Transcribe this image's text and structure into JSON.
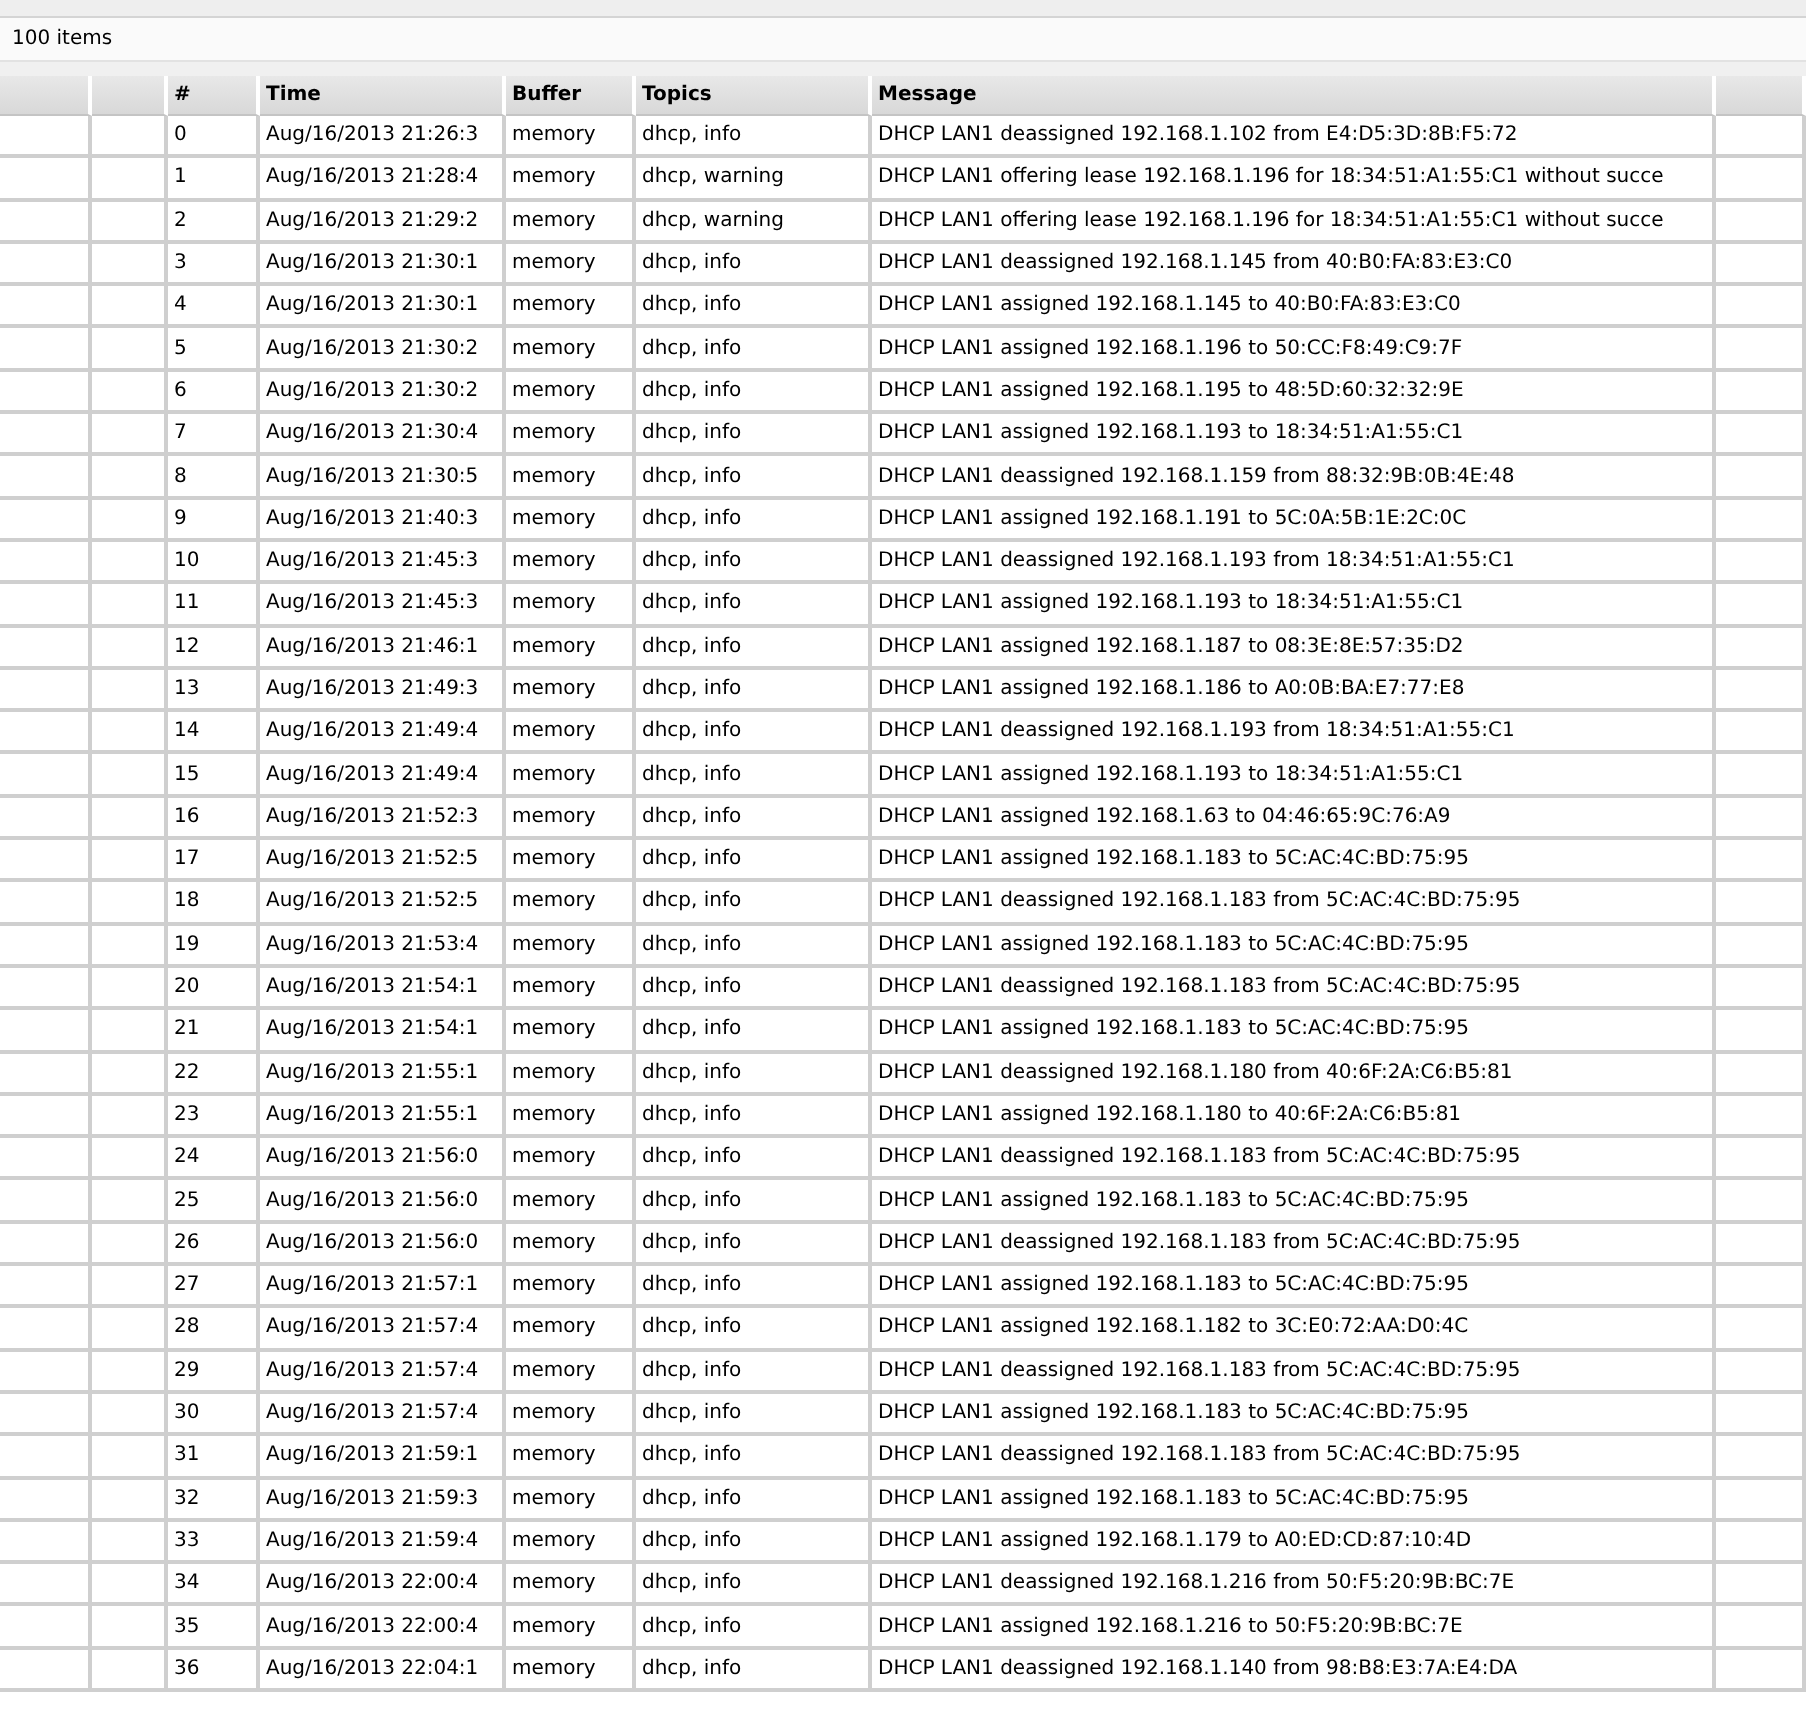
{
  "status": "100 items",
  "columns": [
    "#",
    "Time",
    "Buffer",
    "Topics",
    "Message"
  ],
  "rows": [
    [
      "0",
      "Aug/16/2013 21:26:3",
      "memory",
      "dhcp, info",
      "DHCP LAN1 deassigned 192.168.1.102 from E4:D5:3D:8B:F5:72"
    ],
    [
      "1",
      "Aug/16/2013 21:28:4",
      "memory",
      "dhcp, warning",
      "DHCP LAN1 offering lease 192.168.1.196 for 18:34:51:A1:55:C1 without succe"
    ],
    [
      "2",
      "Aug/16/2013 21:29:2",
      "memory",
      "dhcp, warning",
      "DHCP LAN1 offering lease 192.168.1.196 for 18:34:51:A1:55:C1 without succe"
    ],
    [
      "3",
      "Aug/16/2013 21:30:1",
      "memory",
      "dhcp, info",
      "DHCP LAN1 deassigned 192.168.1.145 from 40:B0:FA:83:E3:C0"
    ],
    [
      "4",
      "Aug/16/2013 21:30:1",
      "memory",
      "dhcp, info",
      "DHCP LAN1 assigned 192.168.1.145 to 40:B0:FA:83:E3:C0"
    ],
    [
      "5",
      "Aug/16/2013 21:30:2",
      "memory",
      "dhcp, info",
      "DHCP LAN1 assigned 192.168.1.196 to 50:CC:F8:49:C9:7F"
    ],
    [
      "6",
      "Aug/16/2013 21:30:2",
      "memory",
      "dhcp, info",
      "DHCP LAN1 assigned 192.168.1.195 to 48:5D:60:32:32:9E"
    ],
    [
      "7",
      "Aug/16/2013 21:30:4",
      "memory",
      "dhcp, info",
      "DHCP LAN1 assigned 192.168.1.193 to 18:34:51:A1:55:C1"
    ],
    [
      "8",
      "Aug/16/2013 21:30:5",
      "memory",
      "dhcp, info",
      "DHCP LAN1 deassigned 192.168.1.159 from 88:32:9B:0B:4E:48"
    ],
    [
      "9",
      "Aug/16/2013 21:40:3",
      "memory",
      "dhcp, info",
      "DHCP LAN1 assigned 192.168.1.191 to 5C:0A:5B:1E:2C:0C"
    ],
    [
      "10",
      "Aug/16/2013 21:45:3",
      "memory",
      "dhcp, info",
      "DHCP LAN1 deassigned 192.168.1.193 from 18:34:51:A1:55:C1"
    ],
    [
      "11",
      "Aug/16/2013 21:45:3",
      "memory",
      "dhcp, info",
      "DHCP LAN1 assigned 192.168.1.193 to 18:34:51:A1:55:C1"
    ],
    [
      "12",
      "Aug/16/2013 21:46:1",
      "memory",
      "dhcp, info",
      "DHCP LAN1 assigned 192.168.1.187 to 08:3E:8E:57:35:D2"
    ],
    [
      "13",
      "Aug/16/2013 21:49:3",
      "memory",
      "dhcp, info",
      "DHCP LAN1 assigned 192.168.1.186 to A0:0B:BA:E7:77:E8"
    ],
    [
      "14",
      "Aug/16/2013 21:49:4",
      "memory",
      "dhcp, info",
      "DHCP LAN1 deassigned 192.168.1.193 from 18:34:51:A1:55:C1"
    ],
    [
      "15",
      "Aug/16/2013 21:49:4",
      "memory",
      "dhcp, info",
      "DHCP LAN1 assigned 192.168.1.193 to 18:34:51:A1:55:C1"
    ],
    [
      "16",
      "Aug/16/2013 21:52:3",
      "memory",
      "dhcp, info",
      "DHCP LAN1 assigned 192.168.1.63 to 04:46:65:9C:76:A9"
    ],
    [
      "17",
      "Aug/16/2013 21:52:5",
      "memory",
      "dhcp, info",
      "DHCP LAN1 assigned 192.168.1.183 to 5C:AC:4C:BD:75:95"
    ],
    [
      "18",
      "Aug/16/2013 21:52:5",
      "memory",
      "dhcp, info",
      "DHCP LAN1 deassigned 192.168.1.183 from 5C:AC:4C:BD:75:95"
    ],
    [
      "19",
      "Aug/16/2013 21:53:4",
      "memory",
      "dhcp, info",
      "DHCP LAN1 assigned 192.168.1.183 to 5C:AC:4C:BD:75:95"
    ],
    [
      "20",
      "Aug/16/2013 21:54:1",
      "memory",
      "dhcp, info",
      "DHCP LAN1 deassigned 192.168.1.183 from 5C:AC:4C:BD:75:95"
    ],
    [
      "21",
      "Aug/16/2013 21:54:1",
      "memory",
      "dhcp, info",
      "DHCP LAN1 assigned 192.168.1.183 to 5C:AC:4C:BD:75:95"
    ],
    [
      "22",
      "Aug/16/2013 21:55:1",
      "memory",
      "dhcp, info",
      "DHCP LAN1 deassigned 192.168.1.180 from 40:6F:2A:C6:B5:81"
    ],
    [
      "23",
      "Aug/16/2013 21:55:1",
      "memory",
      "dhcp, info",
      "DHCP LAN1 assigned 192.168.1.180 to 40:6F:2A:C6:B5:81"
    ],
    [
      "24",
      "Aug/16/2013 21:56:0",
      "memory",
      "dhcp, info",
      "DHCP LAN1 deassigned 192.168.1.183 from 5C:AC:4C:BD:75:95"
    ],
    [
      "25",
      "Aug/16/2013 21:56:0",
      "memory",
      "dhcp, info",
      "DHCP LAN1 assigned 192.168.1.183 to 5C:AC:4C:BD:75:95"
    ],
    [
      "26",
      "Aug/16/2013 21:56:0",
      "memory",
      "dhcp, info",
      "DHCP LAN1 deassigned 192.168.1.183 from 5C:AC:4C:BD:75:95"
    ],
    [
      "27",
      "Aug/16/2013 21:57:1",
      "memory",
      "dhcp, info",
      "DHCP LAN1 assigned 192.168.1.183 to 5C:AC:4C:BD:75:95"
    ],
    [
      "28",
      "Aug/16/2013 21:57:4",
      "memory",
      "dhcp, info",
      "DHCP LAN1 assigned 192.168.1.182 to 3C:E0:72:AA:D0:4C"
    ],
    [
      "29",
      "Aug/16/2013 21:57:4",
      "memory",
      "dhcp, info",
      "DHCP LAN1 deassigned 192.168.1.183 from 5C:AC:4C:BD:75:95"
    ],
    [
      "30",
      "Aug/16/2013 21:57:4",
      "memory",
      "dhcp, info",
      "DHCP LAN1 assigned 192.168.1.183 to 5C:AC:4C:BD:75:95"
    ],
    [
      "31",
      "Aug/16/2013 21:59:1",
      "memory",
      "dhcp, info",
      "DHCP LAN1 deassigned 192.168.1.183 from 5C:AC:4C:BD:75:95"
    ],
    [
      "32",
      "Aug/16/2013 21:59:3",
      "memory",
      "dhcp, info",
      "DHCP LAN1 assigned 192.168.1.183 to 5C:AC:4C:BD:75:95"
    ],
    [
      "33",
      "Aug/16/2013 21:59:4",
      "memory",
      "dhcp, info",
      "DHCP LAN1 assigned 192.168.1.179 to A0:ED:CD:87:10:4D"
    ],
    [
      "34",
      "Aug/16/2013 22:00:4",
      "memory",
      "dhcp, info",
      "DHCP LAN1 deassigned 192.168.1.216 from 50:F5:20:9B:BC:7E"
    ],
    [
      "35",
      "Aug/16/2013 22:00:4",
      "memory",
      "dhcp, info",
      "DHCP LAN1 assigned 192.168.1.216 to 50:F5:20:9B:BC:7E"
    ],
    [
      "36",
      "Aug/16/2013 22:04:1",
      "memory",
      "dhcp, info",
      "DHCP LAN1 deassigned 192.168.1.140 from 98:B8:E3:7A:E4:DA"
    ]
  ]
}
